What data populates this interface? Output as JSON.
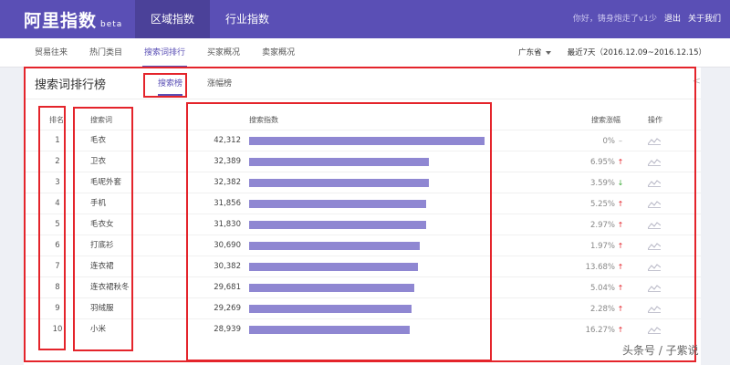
{
  "brand": {
    "name": "阿里指数",
    "badge": "beta"
  },
  "top_nav": [
    "区域指数",
    "行业指数"
  ],
  "top_right": {
    "greeting": "你好，铸身炮走了v1少",
    "logout": "退出",
    "about": "关于我们"
  },
  "sub_nav": [
    "贸易往来",
    "热门类目",
    "搜索词排行",
    "买家概况",
    "卖家概况"
  ],
  "filters": {
    "province": "广东省",
    "date_range": "最近7天（2016.12.09~2016.12.15）"
  },
  "card": {
    "title": "搜索词排行榜",
    "tabs": [
      "搜索榜",
      "涨幅榜"
    ],
    "share_icon": "share-icon"
  },
  "table": {
    "columns": {
      "rank": "排名",
      "keyword": "搜索词",
      "index": "搜索指数",
      "growth": "搜索涨幅",
      "action": "操作"
    },
    "rows": [
      {
        "rank": "1",
        "keyword": "毛衣",
        "index_text": "42,312",
        "index": 42312,
        "growth": "0%",
        "trend": "flat"
      },
      {
        "rank": "2",
        "keyword": "卫衣",
        "index_text": "32,389",
        "index": 32389,
        "growth": "6.95%",
        "trend": "up"
      },
      {
        "rank": "3",
        "keyword": "毛呢外套",
        "index_text": "32,382",
        "index": 32382,
        "growth": "3.59%",
        "trend": "down"
      },
      {
        "rank": "4",
        "keyword": "手机",
        "index_text": "31,856",
        "index": 31856,
        "growth": "5.25%",
        "trend": "up"
      },
      {
        "rank": "5",
        "keyword": "毛衣女",
        "index_text": "31,830",
        "index": 31830,
        "growth": "2.97%",
        "trend": "up"
      },
      {
        "rank": "6",
        "keyword": "打底衫",
        "index_text": "30,690",
        "index": 30690,
        "growth": "1.97%",
        "trend": "up"
      },
      {
        "rank": "7",
        "keyword": "连衣裙",
        "index_text": "30,382",
        "index": 30382,
        "growth": "13.68%",
        "trend": "up"
      },
      {
        "rank": "8",
        "keyword": "连衣裙秋冬",
        "index_text": "29,681",
        "index": 29681,
        "growth": "5.04%",
        "trend": "up"
      },
      {
        "rank": "9",
        "keyword": "羽绒服",
        "index_text": "29,269",
        "index": 29269,
        "growth": "2.28%",
        "trend": "up"
      },
      {
        "rank": "10",
        "keyword": "小米",
        "index_text": "28,939",
        "index": 28939,
        "growth": "16.27%",
        "trend": "up"
      }
    ]
  },
  "trend_colors": {
    "up": "#e4242b",
    "down": "#3aa935",
    "flat": "#999999"
  },
  "trend_glyphs": {
    "up": "↑",
    "down": "↓",
    "flat": "–"
  },
  "action_icon": "trend-chart-icon",
  "watermark": "头条号 / 子紫说"
}
